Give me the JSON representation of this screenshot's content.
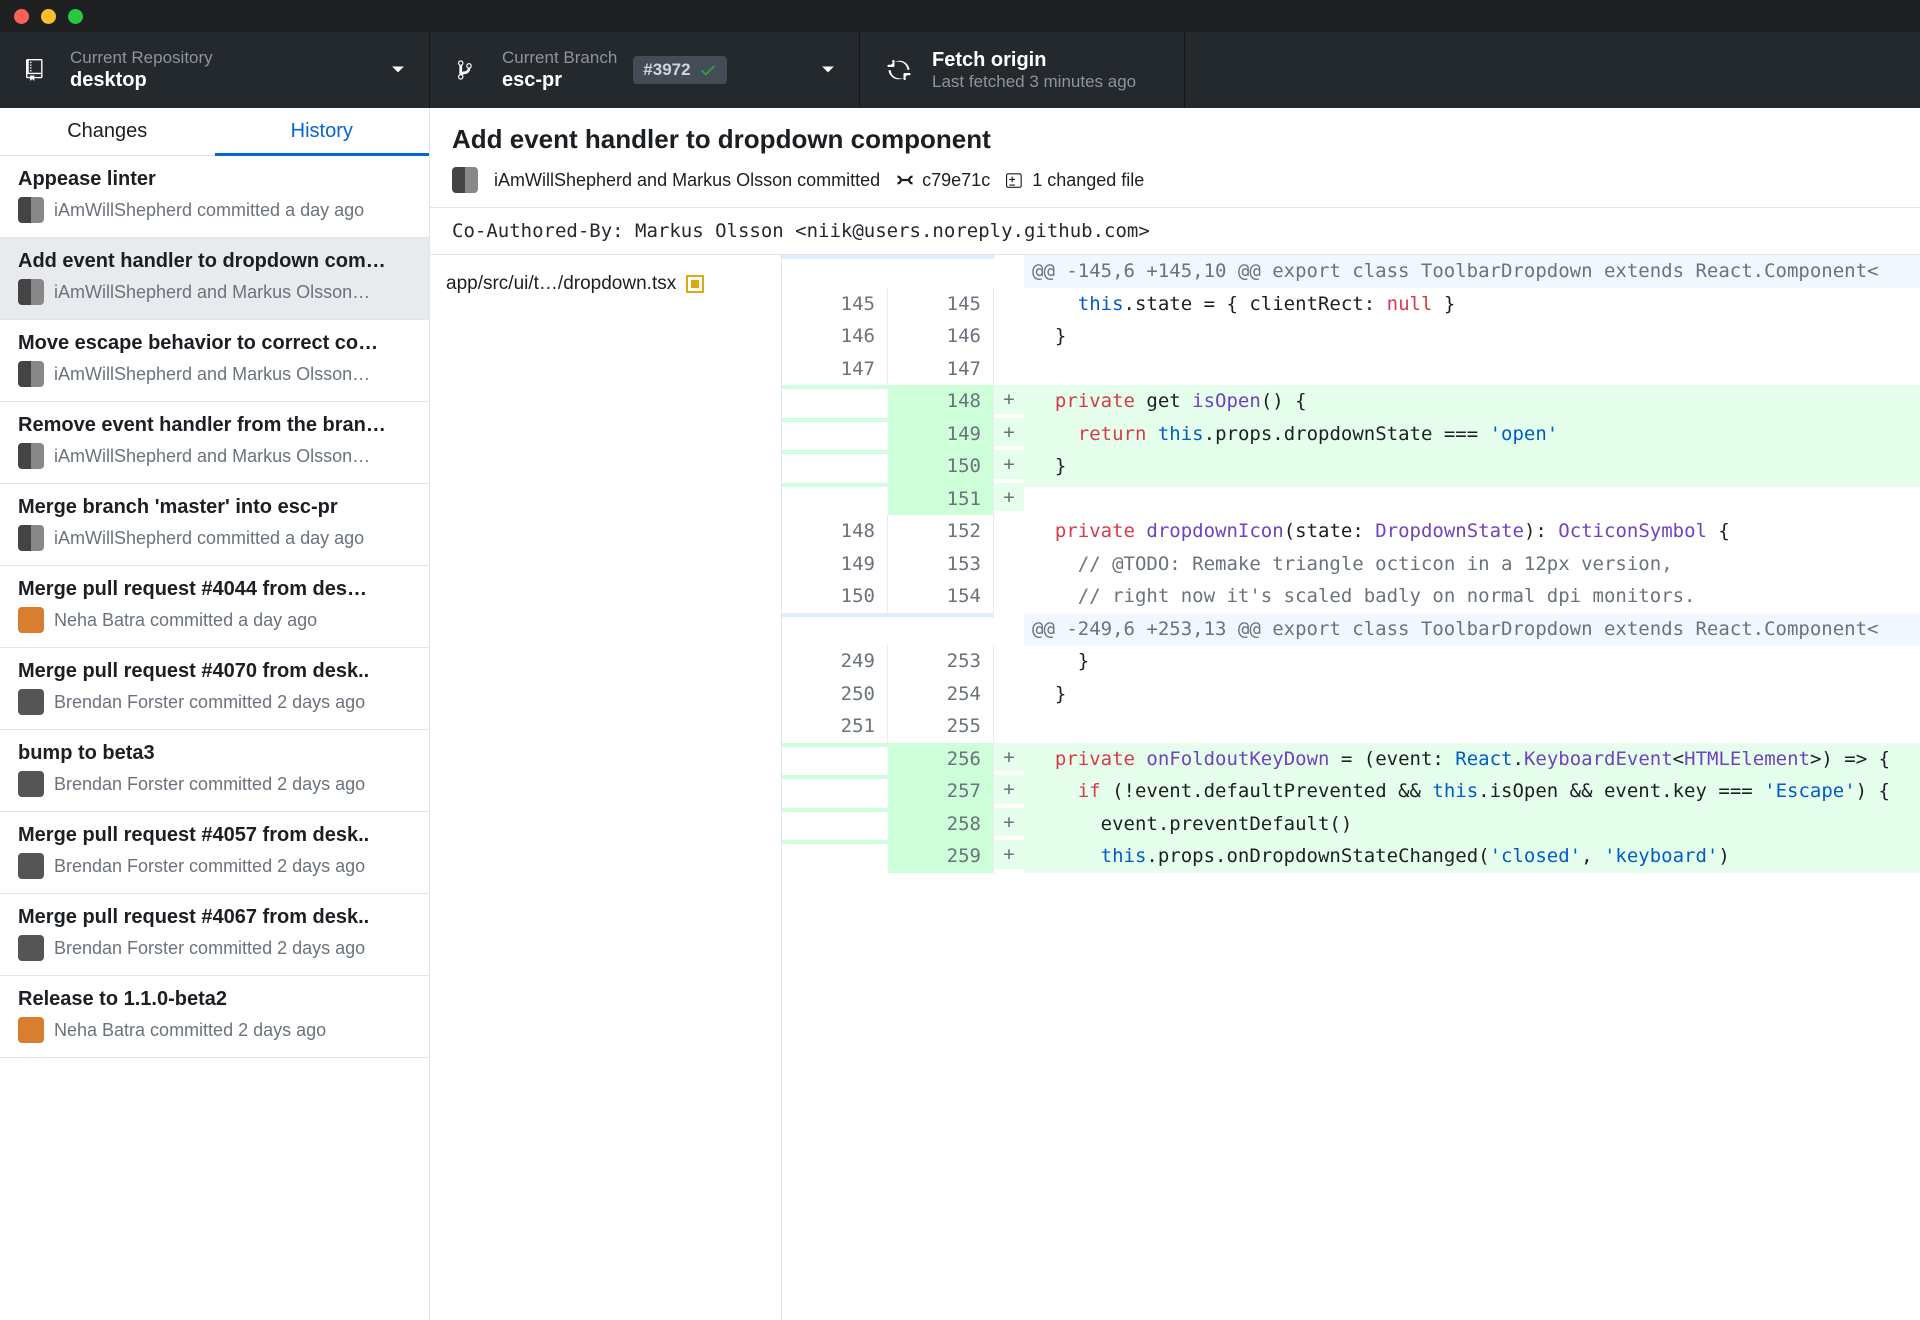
{
  "toolbar": {
    "repo_eyebrow": "Current Repository",
    "repo_name": "desktop",
    "branch_eyebrow": "Current Branch",
    "branch_name": "esc-pr",
    "pr_number": "#3972",
    "fetch_title": "Fetch origin",
    "fetch_sub": "Last fetched 3 minutes ago"
  },
  "side_tabs": {
    "changes": "Changes",
    "history": "History",
    "active": "history"
  },
  "commits": [
    {
      "title": "Appease linter",
      "byline": "iAmWillShepherd committed a day ago",
      "avatar": "duo",
      "selected": false
    },
    {
      "title": "Add event handler to dropdown com…",
      "byline": "iAmWillShepherd and Markus Olsson…",
      "avatar": "duo",
      "selected": true
    },
    {
      "title": "Move escape behavior to correct co…",
      "byline": "iAmWillShepherd and Markus Olsson…",
      "avatar": "duo",
      "selected": false
    },
    {
      "title": "Remove event handler from the bran…",
      "byline": "iAmWillShepherd and Markus Olsson…",
      "avatar": "duo",
      "selected": false
    },
    {
      "title": "Merge branch 'master' into esc-pr",
      "byline": "iAmWillShepherd committed a day ago",
      "avatar": "duo",
      "selected": false
    },
    {
      "title": "Merge pull request #4044 from des…",
      "byline": "Neha Batra committed a day ago",
      "avatar": "orange",
      "selected": false
    },
    {
      "title": "Merge pull request #4070 from desk..",
      "byline": "Brendan Forster committed 2 days ago",
      "avatar": "solo",
      "selected": false
    },
    {
      "title": "bump to beta3",
      "byline": "Brendan Forster committed 2 days ago",
      "avatar": "solo",
      "selected": false
    },
    {
      "title": "Merge pull request #4057 from desk..",
      "byline": "Brendan Forster committed 2 days ago",
      "avatar": "solo",
      "selected": false
    },
    {
      "title": "Merge pull request #4067 from desk..",
      "byline": "Brendan Forster committed 2 days ago",
      "avatar": "solo",
      "selected": false
    },
    {
      "title": "Release to 1.1.0-beta2",
      "byline": "Neha Batra committed 2 days ago",
      "avatar": "orange",
      "selected": false
    }
  ],
  "commit_header": {
    "title": "Add event handler to dropdown component",
    "authors": "iAmWillShepherd and Markus Olsson committed",
    "sha": "c79e71c",
    "files_summary": "1 changed file"
  },
  "coauthor_line": "Co-Authored-By: Markus Olsson <niik@users.noreply.github.com>",
  "files": [
    {
      "path": "app/src/ui/t…/dropdown.tsx",
      "status": "modified",
      "selected": true
    }
  ],
  "diff": [
    {
      "type": "hunk",
      "a": "",
      "b": "",
      "sign": "",
      "text": "@@ -145,6 +145,10 @@ export class ToolbarDropdown extends React.Component<"
    },
    {
      "type": "ctx",
      "a": "145",
      "b": "145",
      "sign": "",
      "tokens": [
        {
          "t": "    "
        },
        {
          "t": "this",
          "c": "this"
        },
        {
          "t": ".state = { clientRect: "
        },
        {
          "t": "null",
          "c": "kw"
        },
        {
          "t": " }"
        }
      ]
    },
    {
      "type": "ctx",
      "a": "146",
      "b": "146",
      "sign": "",
      "tokens": [
        {
          "t": "  }"
        }
      ]
    },
    {
      "type": "ctx",
      "a": "147",
      "b": "147",
      "sign": "",
      "tokens": [
        {
          "t": ""
        }
      ]
    },
    {
      "type": "add",
      "a": "",
      "b": "148",
      "sign": "+",
      "tokens": [
        {
          "t": "  "
        },
        {
          "t": "private",
          "c": "kw"
        },
        {
          "t": " get "
        },
        {
          "t": "isOpen",
          "c": "type"
        },
        {
          "t": "() {"
        }
      ]
    },
    {
      "type": "add",
      "a": "",
      "b": "149",
      "sign": "+",
      "tokens": [
        {
          "t": "    "
        },
        {
          "t": "return",
          "c": "kw"
        },
        {
          "t": " "
        },
        {
          "t": "this",
          "c": "this"
        },
        {
          "t": ".props.dropdownState === "
        },
        {
          "t": "'open'",
          "c": "str"
        }
      ]
    },
    {
      "type": "add",
      "a": "",
      "b": "150",
      "sign": "+",
      "tokens": [
        {
          "t": "  }"
        }
      ]
    },
    {
      "type": "add",
      "a": "",
      "b": "151",
      "sign": "+",
      "tokens": [
        {
          "t": ""
        }
      ]
    },
    {
      "type": "ctx",
      "a": "148",
      "b": "152",
      "sign": "",
      "tokens": [
        {
          "t": "  "
        },
        {
          "t": "private",
          "c": "kw"
        },
        {
          "t": " "
        },
        {
          "t": "dropdownIcon",
          "c": "type"
        },
        {
          "t": "(state: "
        },
        {
          "t": "DropdownState",
          "c": "type"
        },
        {
          "t": "): "
        },
        {
          "t": "OcticonSymbol",
          "c": "type"
        },
        {
          "t": " {"
        }
      ]
    },
    {
      "type": "ctx",
      "a": "149",
      "b": "153",
      "sign": "",
      "tokens": [
        {
          "t": "    "
        },
        {
          "t": "// @TODO: Remake triangle octicon in a 12px version,",
          "c": "com"
        }
      ]
    },
    {
      "type": "ctx",
      "a": "150",
      "b": "154",
      "sign": "",
      "tokens": [
        {
          "t": "    "
        },
        {
          "t": "// right now it's scaled badly on normal dpi monitors.",
          "c": "com"
        }
      ]
    },
    {
      "type": "hunk",
      "a": "",
      "b": "",
      "sign": "",
      "text": "@@ -249,6 +253,13 @@ export class ToolbarDropdown extends React.Component<"
    },
    {
      "type": "ctx",
      "a": "249",
      "b": "253",
      "sign": "",
      "tokens": [
        {
          "t": "    }"
        }
      ]
    },
    {
      "type": "ctx",
      "a": "250",
      "b": "254",
      "sign": "",
      "tokens": [
        {
          "t": "  }"
        }
      ]
    },
    {
      "type": "ctx",
      "a": "251",
      "b": "255",
      "sign": "",
      "tokens": [
        {
          "t": ""
        }
      ]
    },
    {
      "type": "add",
      "a": "",
      "b": "256",
      "sign": "+",
      "tokens": [
        {
          "t": "  "
        },
        {
          "t": "private",
          "c": "kw"
        },
        {
          "t": " "
        },
        {
          "t": "onFoldoutKeyDown",
          "c": "type"
        },
        {
          "t": " = (event: "
        },
        {
          "t": "React",
          "c": "this"
        },
        {
          "t": "."
        },
        {
          "t": "KeyboardEvent",
          "c": "type"
        },
        {
          "t": "<"
        },
        {
          "t": "HTMLElement",
          "c": "type"
        },
        {
          "t": ">) => {"
        }
      ]
    },
    {
      "type": "add",
      "a": "",
      "b": "257",
      "sign": "+",
      "tokens": [
        {
          "t": "    "
        },
        {
          "t": "if",
          "c": "kw"
        },
        {
          "t": " (!event.defaultPrevented && "
        },
        {
          "t": "this",
          "c": "this"
        },
        {
          "t": ".isOpen && event.key === "
        },
        {
          "t": "'Escape'",
          "c": "str"
        },
        {
          "t": ") {"
        }
      ]
    },
    {
      "type": "add",
      "a": "",
      "b": "258",
      "sign": "+",
      "tokens": [
        {
          "t": "      event.preventDefault()"
        }
      ]
    },
    {
      "type": "add",
      "a": "",
      "b": "259",
      "sign": "+",
      "tokens": [
        {
          "t": "      "
        },
        {
          "t": "this",
          "c": "this"
        },
        {
          "t": ".props.onDropdownStateChanged("
        },
        {
          "t": "'closed'",
          "c": "str"
        },
        {
          "t": ", "
        },
        {
          "t": "'keyboard'",
          "c": "str"
        },
        {
          "t": ")"
        }
      ]
    }
  ]
}
